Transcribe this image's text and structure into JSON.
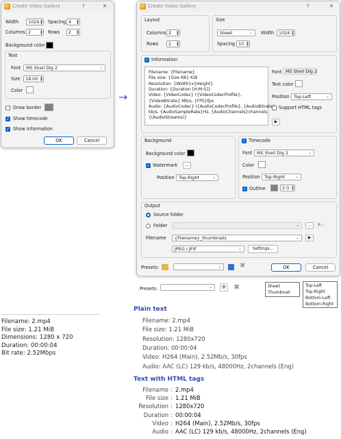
{
  "old_dialog": {
    "title": "Create Video Gallery",
    "help": "?",
    "close": "✕",
    "width_label": "Width",
    "width_value": "1024",
    "spacing_label": "Spacing",
    "spacing_value": "4",
    "columns_label": "Columns",
    "columns_value": "2",
    "rows_label": "Rows",
    "rows_value": "2",
    "bgcolor_label": "Background color",
    "bgcolor": "#000000",
    "text_group": "Text",
    "font_label": "Font",
    "font_value": "MS Shell Dlg 2",
    "size_label": "Size",
    "size_value": "18.00",
    "color_label": "Color",
    "text_color": "#ffffff",
    "draw_border_label": "Draw border",
    "border_color": "#808080",
    "show_timecode_label": "Show timecode",
    "show_information_label": "Show information",
    "ok": "OK",
    "cancel": "Cancel"
  },
  "arrow": "→",
  "new_dialog": {
    "title": "Create Video Gallery",
    "help": "?",
    "close": "✕",
    "layout": {
      "title": "Layout",
      "columns_label": "Columns",
      "columns_value": "2",
      "rows_label": "Rows",
      "rows_value": "2"
    },
    "size": {
      "title": "Size",
      "mode_value": "Sheet",
      "width_label": "Width",
      "width_value": "1024",
      "spacing_label": "Spacing",
      "spacing_value": "10"
    },
    "information": {
      "title": "Information",
      "template_lines": [
        "Filename: {Filename}",
        "File size: {Size KB} KiB",
        "Resolution: {Width}x{Height}",
        "Duration: {Duration [H:M:S]}",
        "Video: {VideoCodec} ({VideoCodecProfile},",
        "{VideoBitrate} Mb/s, {FPS}fps",
        "Audio: {AudioCodec} ({AudioCodecProfile}, {AudioBitrate}",
        "kb/s, {AudioSampleRate}Hz, {AudioChannels}channels",
        "{(AudioStreams)}"
      ],
      "font_label": "Font",
      "font_value": "MS Shell Dlg 2",
      "text_color_label": "Text color",
      "text_color": "#ffffff",
      "position_label": "Position",
      "position_value": "Top-Left",
      "html_label": "Support HTML tags",
      "play": "▶"
    },
    "background": {
      "title": "Background",
      "color_label": "Background color",
      "color": "#000000",
      "watermark_label": "Watermark",
      "watermark_btn": "...",
      "position_label": "Position",
      "position_value": "Top-Right"
    },
    "timecode": {
      "title": "Timecode",
      "font_label": "Font",
      "font_value": "MS Shell Dlg 2",
      "color_label": "Color",
      "color": "#ffffff",
      "position_label": "Position",
      "position_value": "Top-Right",
      "outline_label": "Outline",
      "outline_color": "#808080",
      "outline_value": "2.0"
    },
    "output": {
      "title": "Output",
      "source_folder_label": "Source folder",
      "folder_label": "Folder",
      "folder_btn": "...",
      "filename_label": "Filename",
      "filename_value": "{Filename}_thumbnails",
      "format_value": "JPEG / JFIF",
      "settings_btn": "Settings..."
    },
    "presets_label": "Presets:",
    "ok": "OK",
    "cancel": "Cancel"
  },
  "bottom_presets": {
    "label": "Presets:"
  },
  "size_popup": {
    "items": [
      "Sheet",
      "Thumbnail"
    ]
  },
  "position_popup": {
    "items": [
      "Top-Left",
      "Top-Right",
      "Bottom-Left",
      "Bottom-Right"
    ]
  },
  "info_sample": {
    "lines": [
      "Filename: 2.mp4",
      "File size: 1.21 MiB",
      "Dimensions: 1280 x 720",
      "Duration: 00:00:04",
      "Bit rate: 2.52Mbps"
    ]
  },
  "plain_text": {
    "heading": "Plain text",
    "lines": [
      "Filename: 2.mp4",
      "File size: 1.21 MiB",
      "Resolution: 1280x720",
      "Duration: 00:00:04",
      "Video: H264 (Main), 2.52Mb/s, 30fps",
      "Audio: AAC (LC) 129 kb/s, 48000Hz, 2channels (Eng)"
    ]
  },
  "html_text": {
    "heading": "Text with HTML tags",
    "rows": [
      {
        "key": "Filename",
        "value": "2.mp4"
      },
      {
        "key": "File size",
        "value": "1.21 MiB"
      },
      {
        "key": "Resolution",
        "value": "1280x720"
      },
      {
        "key": "Duration",
        "value": "00:00:04"
      },
      {
        "key": "Video",
        "value": "H264 (Main), 2.52Mb/s, 30fps"
      },
      {
        "key": "Audio",
        "value": "AAC (LC) 129 kb/s, 48000Hz, 2channels (Eng)"
      }
    ]
  }
}
